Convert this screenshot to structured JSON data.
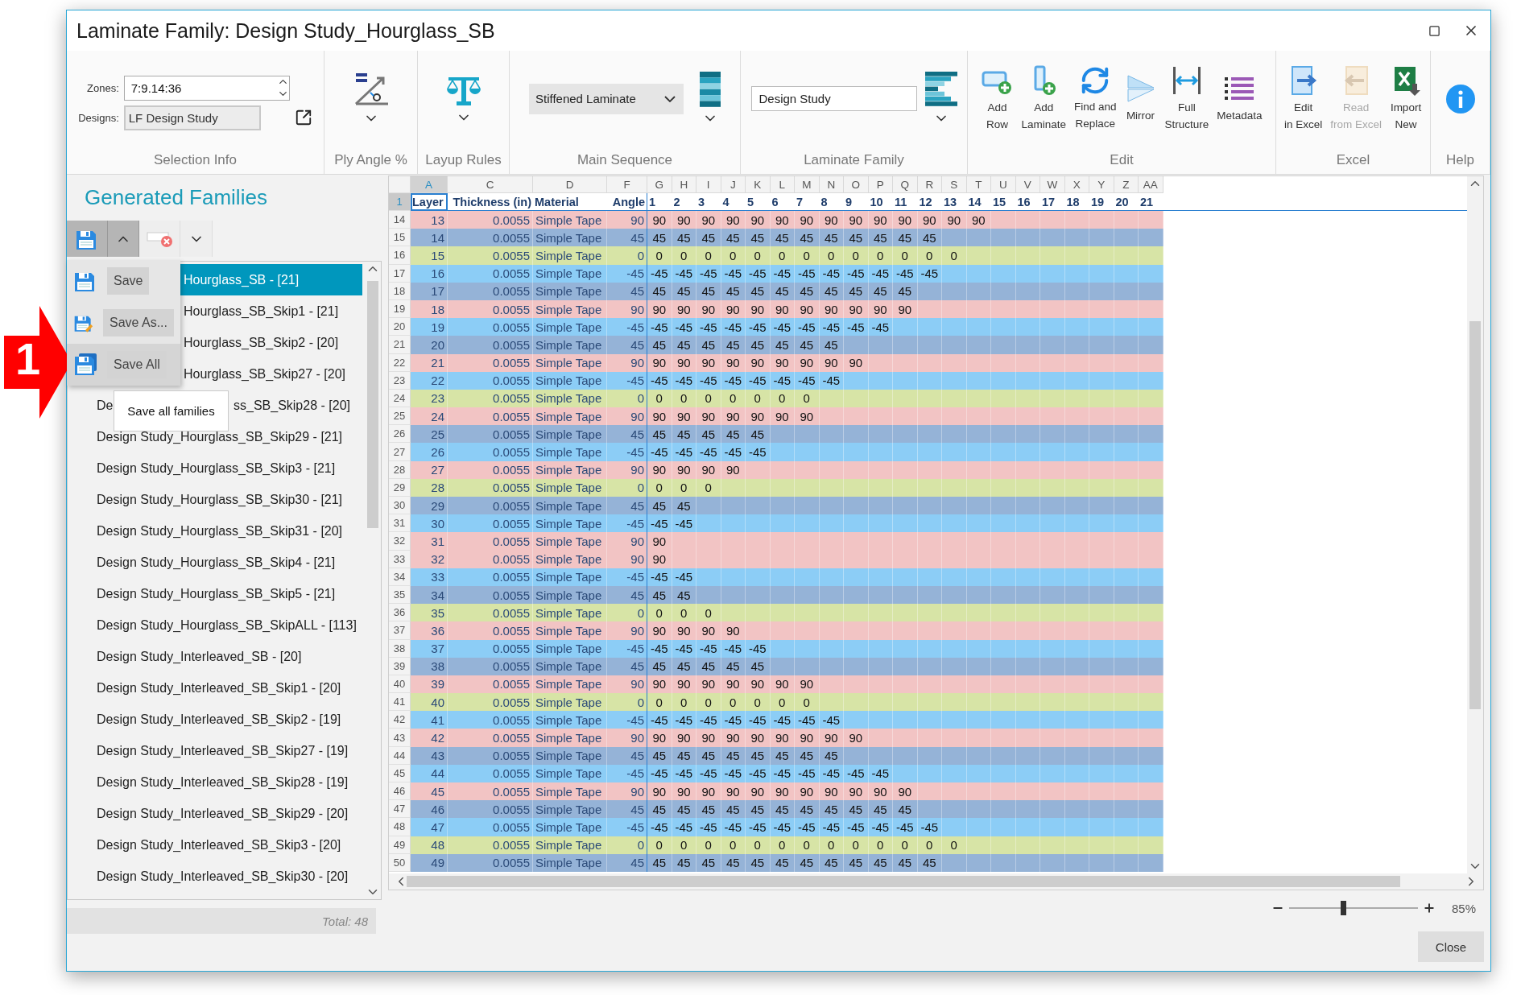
{
  "window": {
    "title": "Laminate Family: Design Study_Hourglass_SB"
  },
  "selection_info": {
    "label": "Selection Info",
    "zones_label": "Zones:",
    "zones_value": "7:9.14:36",
    "designs_label": "Designs:",
    "designs_value": "LF Design Study"
  },
  "ply_angle": {
    "label": "Ply Angle %"
  },
  "layup_rules": {
    "label": "Layup Rules"
  },
  "main_sequence": {
    "label": "Main Sequence",
    "value": "Stiffened Laminate"
  },
  "laminate_family": {
    "label": "Laminate Family",
    "value": "Design Study"
  },
  "edit": {
    "label": "Edit",
    "buttons": [
      {
        "kind": "add-row",
        "label": "Add\nRow"
      },
      {
        "kind": "add-laminate",
        "label": "Add\nLaminate"
      },
      {
        "kind": "find-replace",
        "label": "Find and\nReplace"
      },
      {
        "kind": "mirror",
        "label": "Mirror\n "
      },
      {
        "kind": "full-structure",
        "label": "Full\nStructure"
      },
      {
        "kind": "metadata",
        "label": "Metadata\n "
      }
    ]
  },
  "excel": {
    "label": "Excel",
    "buttons": [
      {
        "kind": "edit-excel",
        "label": "Edit\nin Excel",
        "disabled": false
      },
      {
        "kind": "read-excel",
        "label": "Read\nfrom Excel",
        "disabled": true
      },
      {
        "kind": "import-new",
        "label": "Import\nNew",
        "disabled": false
      }
    ]
  },
  "help": {
    "label": "Help"
  },
  "families": {
    "title": "Generated Families",
    "menu": {
      "open": true,
      "items": [
        {
          "kind": "save",
          "label": "Save",
          "highlighted": false
        },
        {
          "kind": "save-as",
          "label": "Save As...",
          "highlighted": false
        },
        {
          "kind": "save-all",
          "label": "Save All",
          "highlighted": true
        }
      ]
    },
    "tooltip": "Save all families",
    "items": [
      {
        "kind": "covered",
        "label": "Hourglass_SB - [21]",
        "selected": true
      },
      {
        "kind": "covered",
        "label": "Hourglass_SB_Skip1 - [21]",
        "selected": false
      },
      {
        "kind": "covered",
        "label": "Hourglass_SB_Skip2 - [20]",
        "selected": false
      },
      {
        "kind": "covered",
        "label": "Hourglass_SB_Skip27 - [20]",
        "selected": false
      },
      {
        "kind": "split",
        "lead": "De",
        "label": "ss_SB_Skip28 - [20]",
        "selected": false
      },
      {
        "kind": "full",
        "label": "Design Study_Hourglass_SB_Skip29 - [21]",
        "selected": false
      },
      {
        "kind": "full",
        "label": "Design Study_Hourglass_SB_Skip3 - [21]",
        "selected": false
      },
      {
        "kind": "full",
        "label": "Design Study_Hourglass_SB_Skip30 - [21]",
        "selected": false
      },
      {
        "kind": "full",
        "label": "Design Study_Hourglass_SB_Skip31 - [20]",
        "selected": false
      },
      {
        "kind": "full",
        "label": "Design Study_Hourglass_SB_Skip4 - [21]",
        "selected": false
      },
      {
        "kind": "full",
        "label": "Design Study_Hourglass_SB_Skip5 - [21]",
        "selected": false
      },
      {
        "kind": "full",
        "label": "Design Study_Hourglass_SB_SkipALL - [113]",
        "selected": false
      },
      {
        "kind": "full",
        "label": "Design Study_Interleaved_SB - [20]",
        "selected": false
      },
      {
        "kind": "full",
        "label": "Design Study_Interleaved_SB_Skip1 - [20]",
        "selected": false
      },
      {
        "kind": "full",
        "label": "Design Study_Interleaved_SB_Skip2 - [19]",
        "selected": false
      },
      {
        "kind": "full",
        "label": "Design Study_Interleaved_SB_Skip27 - [19]",
        "selected": false
      },
      {
        "kind": "full",
        "label": "Design Study_Interleaved_SB_Skip28 - [19]",
        "selected": false
      },
      {
        "kind": "full",
        "label": "Design Study_Interleaved_SB_Skip29 - [20]",
        "selected": false
      },
      {
        "kind": "full",
        "label": "Design Study_Interleaved_SB_Skip3 - [20]",
        "selected": false
      },
      {
        "kind": "full",
        "label": "Design Study_Interleaved_SB_Skip30 - [20]",
        "selected": false
      }
    ],
    "total": "Total: 48"
  },
  "callout": {
    "number": "1"
  },
  "sheet": {
    "columns": [
      {
        "letter": "A",
        "selected": true
      },
      {
        "letter": "C",
        "selected": false
      },
      {
        "letter": "D",
        "selected": false
      },
      {
        "letter": "F",
        "selected": false
      },
      {
        "letter": "G",
        "selected": false
      },
      {
        "letter": "H",
        "selected": false
      },
      {
        "letter": "I",
        "selected": false
      },
      {
        "letter": "J",
        "selected": false
      },
      {
        "letter": "K",
        "selected": false
      },
      {
        "letter": "L",
        "selected": false
      },
      {
        "letter": "M",
        "selected": false
      },
      {
        "letter": "N",
        "selected": false
      },
      {
        "letter": "O",
        "selected": false
      },
      {
        "letter": "P",
        "selected": false
      },
      {
        "letter": "Q",
        "selected": false
      },
      {
        "letter": "R",
        "selected": false
      },
      {
        "letter": "S",
        "selected": false
      },
      {
        "letter": "T",
        "selected": false
      },
      {
        "letter": "U",
        "selected": false
      },
      {
        "letter": "V",
        "selected": false
      },
      {
        "letter": "W",
        "selected": false
      },
      {
        "letter": "X",
        "selected": false
      },
      {
        "letter": "Y",
        "selected": false
      },
      {
        "letter": "Z",
        "selected": false
      },
      {
        "letter": "AA",
        "selected": false
      }
    ],
    "header_row_number": "1",
    "headers": [
      "Layer",
      "Thickness (in)",
      "Material",
      "Angle",
      "1",
      "2",
      "3",
      "4",
      "5",
      "6",
      "7",
      "8",
      "9",
      "10",
      "11",
      "12",
      "13",
      "14",
      "15",
      "16",
      "17",
      "18",
      "19",
      "20",
      "21"
    ],
    "rows": [
      {
        "number": "14",
        "layer": "13",
        "thickness": "0.0055",
        "material": "Simple Tape",
        "angle": "90",
        "color": "#f2c4c4",
        "plies": [
          "90",
          "90",
          "90",
          "90",
          "90",
          "90",
          "90",
          "90",
          "90",
          "90",
          "90",
          "90",
          "90",
          "90"
        ]
      },
      {
        "number": "15",
        "layer": "14",
        "thickness": "0.0055",
        "material": "Simple Tape",
        "angle": "45",
        "color": "#95b3d7",
        "plies": [
          "45",
          "45",
          "45",
          "45",
          "45",
          "45",
          "45",
          "45",
          "45",
          "45",
          "45",
          "45"
        ]
      },
      {
        "number": "16",
        "layer": "15",
        "thickness": "0.0055",
        "material": "Simple Tape",
        "angle": "0",
        "color": "#d7e4a6",
        "plies": [
          "0",
          "0",
          "0",
          "0",
          "0",
          "0",
          "0",
          "0",
          "0",
          "0",
          "0",
          "0",
          "0"
        ]
      },
      {
        "number": "17",
        "layer": "16",
        "thickness": "0.0055",
        "material": "Simple Tape",
        "angle": "-45",
        "color": "#8ccdf6",
        "plies": [
          "-45",
          "-45",
          "-45",
          "-45",
          "-45",
          "-45",
          "-45",
          "-45",
          "-45",
          "-45",
          "-45",
          "-45"
        ]
      },
      {
        "number": "18",
        "layer": "17",
        "thickness": "0.0055",
        "material": "Simple Tape",
        "angle": "45",
        "color": "#95b3d7",
        "plies": [
          "45",
          "45",
          "45",
          "45",
          "45",
          "45",
          "45",
          "45",
          "45",
          "45",
          "45"
        ]
      },
      {
        "number": "19",
        "layer": "18",
        "thickness": "0.0055",
        "material": "Simple Tape",
        "angle": "90",
        "color": "#f2c4c4",
        "plies": [
          "90",
          "90",
          "90",
          "90",
          "90",
          "90",
          "90",
          "90",
          "90",
          "90",
          "90"
        ]
      },
      {
        "number": "20",
        "layer": "19",
        "thickness": "0.0055",
        "material": "Simple Tape",
        "angle": "-45",
        "color": "#8ccdf6",
        "plies": [
          "-45",
          "-45",
          "-45",
          "-45",
          "-45",
          "-45",
          "-45",
          "-45",
          "-45",
          "-45"
        ]
      },
      {
        "number": "21",
        "layer": "20",
        "thickness": "0.0055",
        "material": "Simple Tape",
        "angle": "45",
        "color": "#95b3d7",
        "plies": [
          "45",
          "45",
          "45",
          "45",
          "45",
          "45",
          "45",
          "45"
        ]
      },
      {
        "number": "22",
        "layer": "21",
        "thickness": "0.0055",
        "material": "Simple Tape",
        "angle": "90",
        "color": "#f2c4c4",
        "plies": [
          "90",
          "90",
          "90",
          "90",
          "90",
          "90",
          "90",
          "90",
          "90"
        ]
      },
      {
        "number": "23",
        "layer": "22",
        "thickness": "0.0055",
        "material": "Simple Tape",
        "angle": "-45",
        "color": "#8ccdf6",
        "plies": [
          "-45",
          "-45",
          "-45",
          "-45",
          "-45",
          "-45",
          "-45",
          "-45"
        ]
      },
      {
        "number": "24",
        "layer": "23",
        "thickness": "0.0055",
        "material": "Simple Tape",
        "angle": "0",
        "color": "#d7e4a6",
        "plies": [
          "0",
          "0",
          "0",
          "0",
          "0",
          "0",
          "0"
        ]
      },
      {
        "number": "25",
        "layer": "24",
        "thickness": "0.0055",
        "material": "Simple Tape",
        "angle": "90",
        "color": "#f2c4c4",
        "plies": [
          "90",
          "90",
          "90",
          "90",
          "90",
          "90",
          "90"
        ]
      },
      {
        "number": "26",
        "layer": "25",
        "thickness": "0.0055",
        "material": "Simple Tape",
        "angle": "45",
        "color": "#95b3d7",
        "plies": [
          "45",
          "45",
          "45",
          "45",
          "45"
        ]
      },
      {
        "number": "27",
        "layer": "26",
        "thickness": "0.0055",
        "material": "Simple Tape",
        "angle": "-45",
        "color": "#8ccdf6",
        "plies": [
          "-45",
          "-45",
          "-45",
          "-45",
          "-45"
        ]
      },
      {
        "number": "28",
        "layer": "27",
        "thickness": "0.0055",
        "material": "Simple Tape",
        "angle": "90",
        "color": "#f2c4c4",
        "plies": [
          "90",
          "90",
          "90",
          "90"
        ]
      },
      {
        "number": "29",
        "layer": "28",
        "thickness": "0.0055",
        "material": "Simple Tape",
        "angle": "0",
        "color": "#d7e4a6",
        "plies": [
          "0",
          "0",
          "0"
        ]
      },
      {
        "number": "30",
        "layer": "29",
        "thickness": "0.0055",
        "material": "Simple Tape",
        "angle": "45",
        "color": "#95b3d7",
        "plies": [
          "45",
          "45"
        ]
      },
      {
        "number": "31",
        "layer": "30",
        "thickness": "0.0055",
        "material": "Simple Tape",
        "angle": "-45",
        "color": "#8ccdf6",
        "plies": [
          "-45",
          "-45"
        ]
      },
      {
        "number": "32",
        "layer": "31",
        "thickness": "0.0055",
        "material": "Simple Tape",
        "angle": "90",
        "color": "#f2c4c4",
        "plies": [
          "90"
        ]
      },
      {
        "number": "33",
        "layer": "32",
        "thickness": "0.0055",
        "material": "Simple Tape",
        "angle": "90",
        "color": "#f2c4c4",
        "plies": [
          "90"
        ]
      },
      {
        "number": "34",
        "layer": "33",
        "thickness": "0.0055",
        "material": "Simple Tape",
        "angle": "-45",
        "color": "#8ccdf6",
        "plies": [
          "-45",
          "-45"
        ]
      },
      {
        "number": "35",
        "layer": "34",
        "thickness": "0.0055",
        "material": "Simple Tape",
        "angle": "45",
        "color": "#95b3d7",
        "plies": [
          "45",
          "45"
        ]
      },
      {
        "number": "36",
        "layer": "35",
        "thickness": "0.0055",
        "material": "Simple Tape",
        "angle": "0",
        "color": "#d7e4a6",
        "plies": [
          "0",
          "0",
          "0"
        ]
      },
      {
        "number": "37",
        "layer": "36",
        "thickness": "0.0055",
        "material": "Simple Tape",
        "angle": "90",
        "color": "#f2c4c4",
        "plies": [
          "90",
          "90",
          "90",
          "90"
        ]
      },
      {
        "number": "38",
        "layer": "37",
        "thickness": "0.0055",
        "material": "Simple Tape",
        "angle": "-45",
        "color": "#8ccdf6",
        "plies": [
          "-45",
          "-45",
          "-45",
          "-45",
          "-45"
        ]
      },
      {
        "number": "39",
        "layer": "38",
        "thickness": "0.0055",
        "material": "Simple Tape",
        "angle": "45",
        "color": "#95b3d7",
        "plies": [
          "45",
          "45",
          "45",
          "45",
          "45"
        ]
      },
      {
        "number": "40",
        "layer": "39",
        "thickness": "0.0055",
        "material": "Simple Tape",
        "angle": "90",
        "color": "#f2c4c4",
        "plies": [
          "90",
          "90",
          "90",
          "90",
          "90",
          "90",
          "90"
        ]
      },
      {
        "number": "41",
        "layer": "40",
        "thickness": "0.0055",
        "material": "Simple Tape",
        "angle": "0",
        "color": "#d7e4a6",
        "plies": [
          "0",
          "0",
          "0",
          "0",
          "0",
          "0",
          "0"
        ]
      },
      {
        "number": "42",
        "layer": "41",
        "thickness": "0.0055",
        "material": "Simple Tape",
        "angle": "-45",
        "color": "#8ccdf6",
        "plies": [
          "-45",
          "-45",
          "-45",
          "-45",
          "-45",
          "-45",
          "-45",
          "-45"
        ]
      },
      {
        "number": "43",
        "layer": "42",
        "thickness": "0.0055",
        "material": "Simple Tape",
        "angle": "90",
        "color": "#f2c4c4",
        "plies": [
          "90",
          "90",
          "90",
          "90",
          "90",
          "90",
          "90",
          "90",
          "90"
        ]
      },
      {
        "number": "44",
        "layer": "43",
        "thickness": "0.0055",
        "material": "Simple Tape",
        "angle": "45",
        "color": "#95b3d7",
        "plies": [
          "45",
          "45",
          "45",
          "45",
          "45",
          "45",
          "45",
          "45"
        ]
      },
      {
        "number": "45",
        "layer": "44",
        "thickness": "0.0055",
        "material": "Simple Tape",
        "angle": "-45",
        "color": "#8ccdf6",
        "plies": [
          "-45",
          "-45",
          "-45",
          "-45",
          "-45",
          "-45",
          "-45",
          "-45",
          "-45",
          "-45"
        ]
      },
      {
        "number": "46",
        "layer": "45",
        "thickness": "0.0055",
        "material": "Simple Tape",
        "angle": "90",
        "color": "#f2c4c4",
        "plies": [
          "90",
          "90",
          "90",
          "90",
          "90",
          "90",
          "90",
          "90",
          "90",
          "90",
          "90"
        ]
      },
      {
        "number": "47",
        "layer": "46",
        "thickness": "0.0055",
        "material": "Simple Tape",
        "angle": "45",
        "color": "#95b3d7",
        "plies": [
          "45",
          "45",
          "45",
          "45",
          "45",
          "45",
          "45",
          "45",
          "45",
          "45",
          "45"
        ]
      },
      {
        "number": "48",
        "layer": "47",
        "thickness": "0.0055",
        "material": "Simple Tape",
        "angle": "-45",
        "color": "#8ccdf6",
        "plies": [
          "-45",
          "-45",
          "-45",
          "-45",
          "-45",
          "-45",
          "-45",
          "-45",
          "-45",
          "-45",
          "-45",
          "-45"
        ]
      },
      {
        "number": "49",
        "layer": "48",
        "thickness": "0.0055",
        "material": "Simple Tape",
        "angle": "0",
        "color": "#d7e4a6",
        "plies": [
          "0",
          "0",
          "0",
          "0",
          "0",
          "0",
          "0",
          "0",
          "0",
          "0",
          "0",
          "0",
          "0"
        ]
      },
      {
        "number": "50",
        "layer": "49",
        "thickness": "0.0055",
        "material": "Simple Tape",
        "angle": "45",
        "color": "#95b3d7",
        "plies": [
          "45",
          "45",
          "45",
          "45",
          "45",
          "45",
          "45",
          "45",
          "45",
          "45",
          "45",
          "45"
        ]
      }
    ]
  },
  "zoom": {
    "level": 0.42,
    "reading": "85%"
  },
  "close_button": "Close"
}
